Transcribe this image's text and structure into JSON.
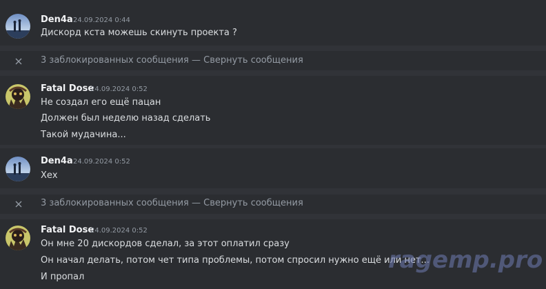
{
  "messages": [
    {
      "author": "Den4a",
      "timestamp": "24.09.2024 0:44",
      "avatar_icon": "den4a-avatar-icon",
      "lines": [
        "Дискорд кста можешь скинуть проекта ?"
      ]
    },
    {
      "author": "Fatal Dose",
      "timestamp": "24.09.2024 0:52",
      "avatar_icon": "fatal-dose-avatar-icon",
      "lines": [
        "Не создал его ещё пацан",
        "Должен был неделю назад сделать",
        "Такой мудачина..."
      ]
    },
    {
      "author": "Den4a",
      "timestamp": "24.09.2024 0:52",
      "avatar_icon": "den4a-avatar-icon",
      "lines": [
        "Хех"
      ]
    },
    {
      "author": "Fatal Dose",
      "timestamp": "24.09.2024 0:52",
      "avatar_icon": "fatal-dose-avatar-icon",
      "lines": [
        "Он мне 20 дискордов сделал, за этот оплатил сразу",
        "Он начал делать, потом чет типа проблемы, потом спросил нужно ещё или нет...",
        "И пропал"
      ]
    }
  ],
  "blocked": [
    {
      "count_text": "3 заблокированных сообщения",
      "separator": " — ",
      "collapse_label": "Свернуть сообщения",
      "icon": "close-icon"
    },
    {
      "count_text": "3 заблокированных сообщения",
      "separator": " — ",
      "collapse_label": "Свернуть сообщения",
      "icon": "close-icon"
    }
  ],
  "watermark": "ragemp.pro",
  "colors": {
    "background": "#313338",
    "message_hover": "#2b2d31",
    "username": "#f2f3f5",
    "text": "#dbdee1",
    "muted": "#949ba4"
  }
}
